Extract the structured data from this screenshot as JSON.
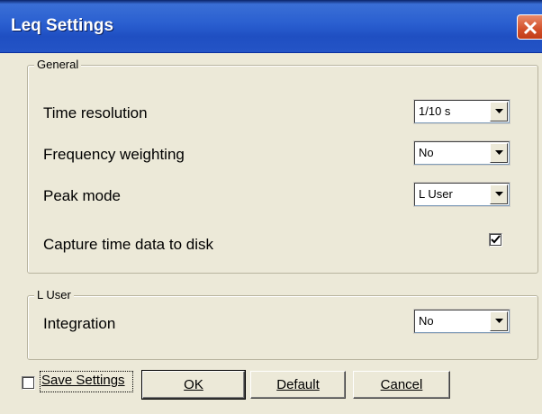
{
  "window": {
    "title": "Leq Settings"
  },
  "general": {
    "legend": "General",
    "time_resolution": {
      "label": "Time resolution",
      "value": "1/10 s"
    },
    "frequency_weighting": {
      "label": "Frequency weighting",
      "value": "No"
    },
    "peak_mode": {
      "label": "Peak mode",
      "value": "L User"
    },
    "capture": {
      "label": "Capture time data to disk",
      "checked": true
    }
  },
  "l_user": {
    "legend": "L User",
    "integration": {
      "label": "Integration",
      "value": "No"
    }
  },
  "footer": {
    "save_settings": {
      "label": "Save Settings",
      "checked": false
    },
    "ok_label": "OK",
    "default_label": "Default",
    "cancel_label": "Cancel"
  }
}
